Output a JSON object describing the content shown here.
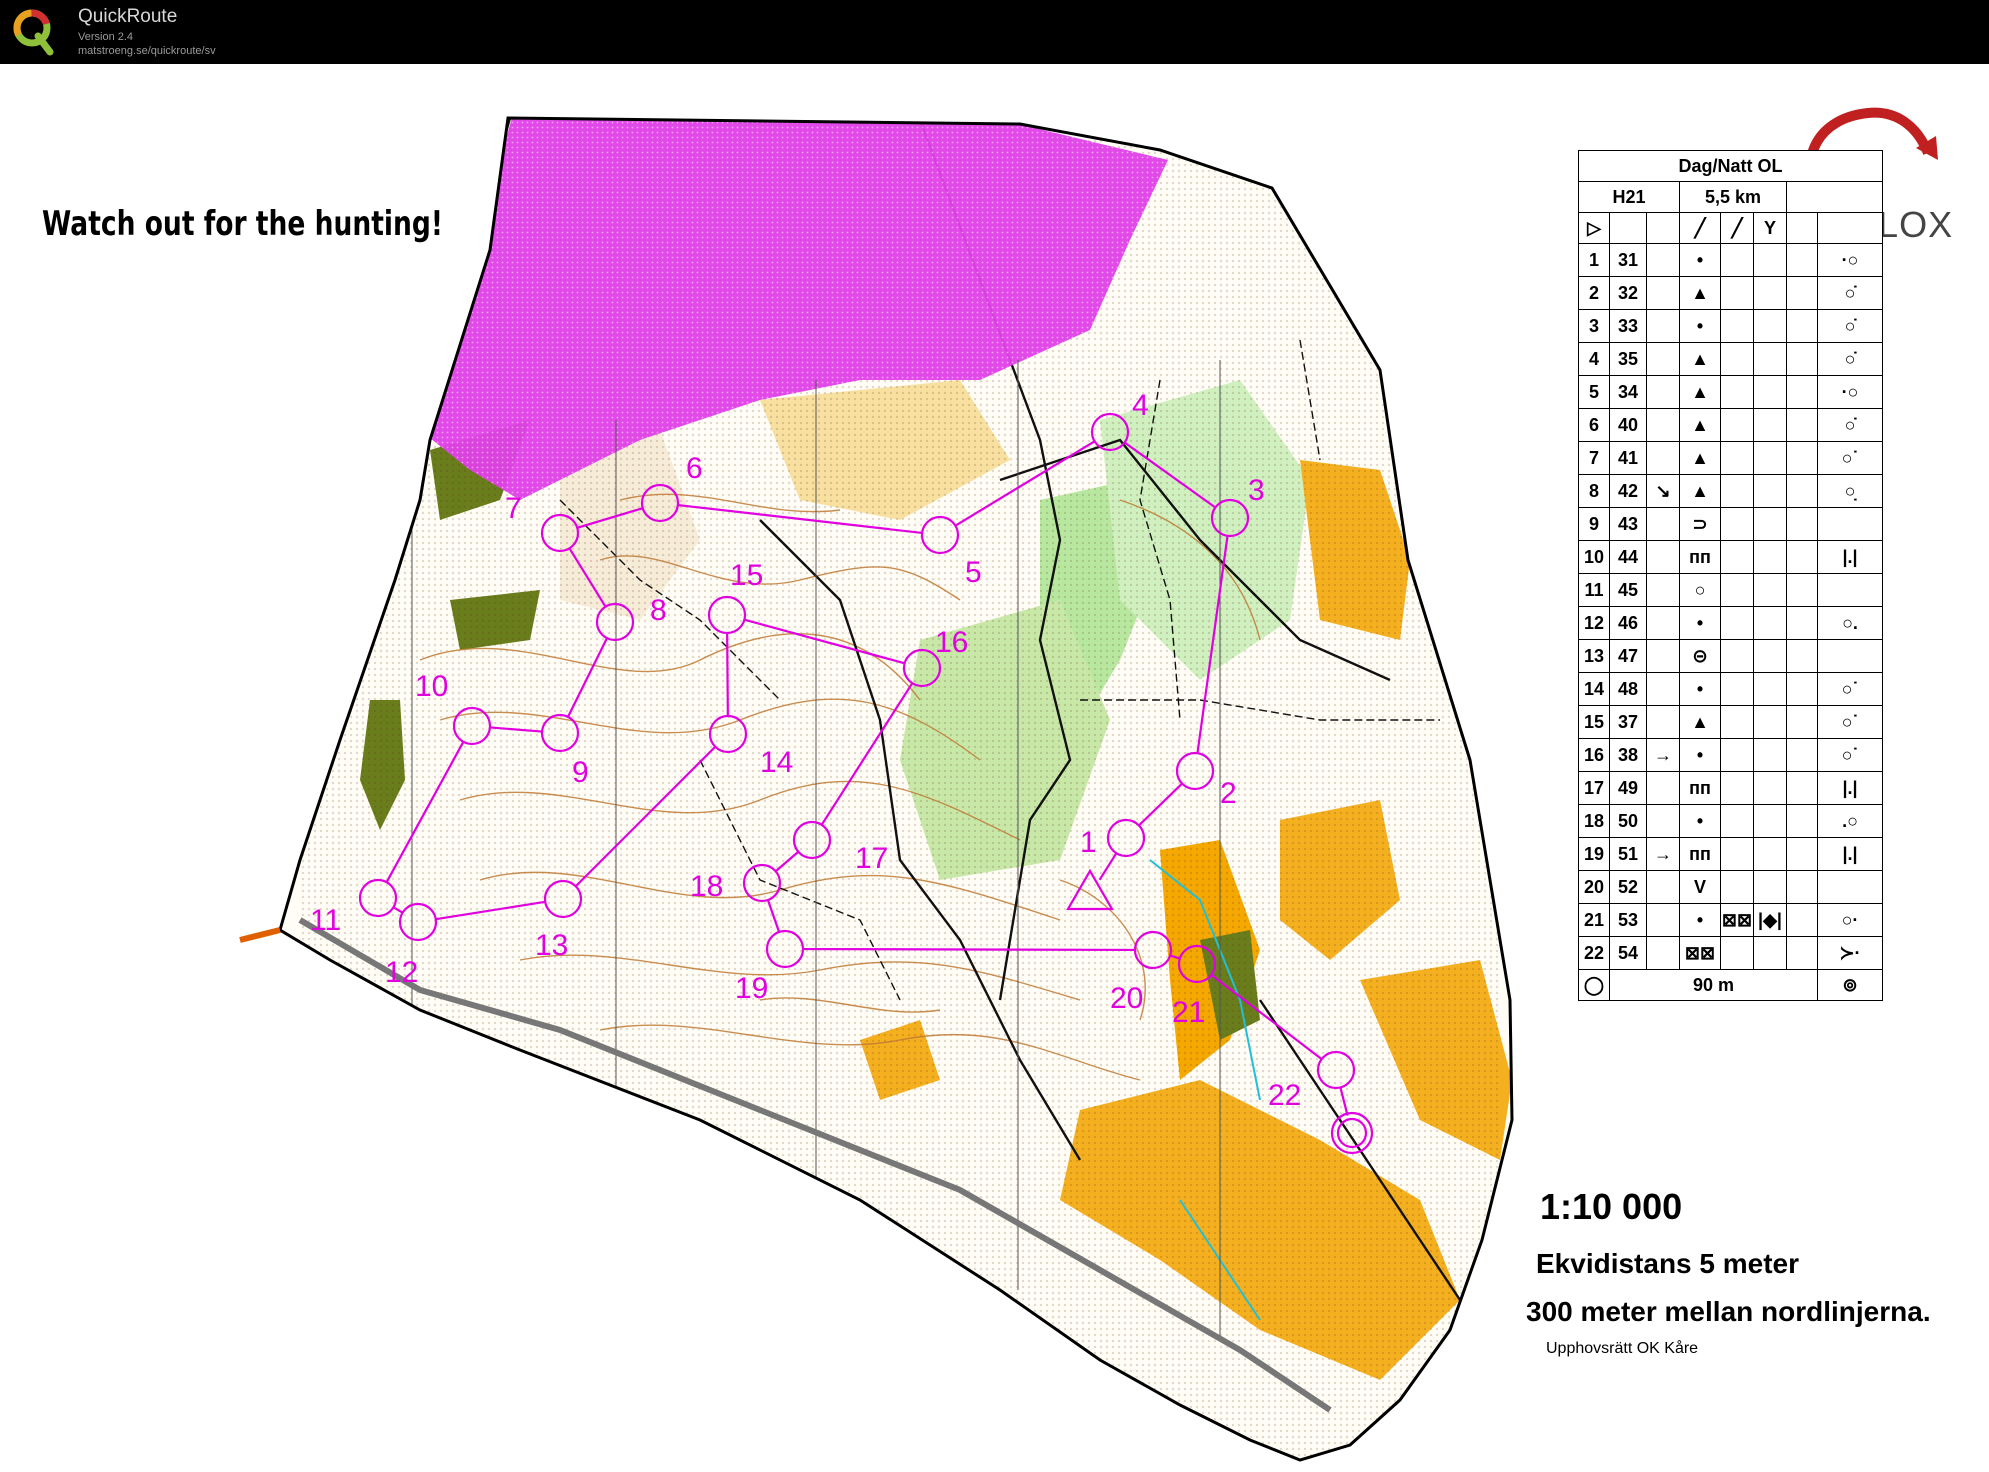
{
  "app": {
    "name": "QuickRoute",
    "version": "Version 2.4",
    "url": "matstroeng.se/quickroute/sv"
  },
  "map": {
    "warning": "Watch out for the hunting!",
    "brand": "LIVELOX",
    "scale": "1:10 000",
    "contour_interval": "Ekvidistans 5 meter",
    "north_lines": "300 meter mellan nordlinjerna.",
    "copyright": "Upphovsrätt OK Kåre",
    "colors": {
      "course": "#e000e0",
      "restricted": "#e040e8",
      "open_land": "#f5a800",
      "rough_open": "#f8e0a0",
      "green": "#a8e08c",
      "dark_green": "#6a7d1c",
      "contour": "#b8702a",
      "water": "#30c8e0"
    }
  },
  "course": {
    "event": "Dag/Natt OL",
    "class": "H21",
    "length": "5,5 km",
    "finish_distance": "90 m",
    "controls": [
      {
        "n": "1",
        "code": "31",
        "c": "•",
        "g": "·○"
      },
      {
        "n": "2",
        "code": "32",
        "c": "▲",
        "g": "○̇"
      },
      {
        "n": "3",
        "code": "33",
        "c": "•",
        "g": "○̇"
      },
      {
        "n": "4",
        "code": "35",
        "c": "▲",
        "g": "○̇"
      },
      {
        "n": "5",
        "code": "34",
        "c": "▲",
        "g": "·○"
      },
      {
        "n": "6",
        "code": "40",
        "c": "▲",
        "g": "○̇"
      },
      {
        "n": "7",
        "code": "41",
        "c": "▲",
        "g": "○˙"
      },
      {
        "n": "8",
        "code": "42",
        "c": "▲",
        "g": "○̣",
        "d": "↘"
      },
      {
        "n": "9",
        "code": "43",
        "c": "⊃",
        "g": ""
      },
      {
        "n": "10",
        "code": "44",
        "c": "ᴨᴨ",
        "g": "|.|"
      },
      {
        "n": "11",
        "code": "45",
        "c": "○",
        "g": ""
      },
      {
        "n": "12",
        "code": "46",
        "c": "•",
        "g": "○."
      },
      {
        "n": "13",
        "code": "47",
        "c": "⊝",
        "g": ""
      },
      {
        "n": "14",
        "code": "48",
        "c": "•",
        "g": "○˙"
      },
      {
        "n": "15",
        "code": "37",
        "c": "▲",
        "g": "○˙"
      },
      {
        "n": "16",
        "code": "38",
        "c": "•",
        "g": "○˙",
        "d": "→"
      },
      {
        "n": "17",
        "code": "49",
        "c": "ᴨᴨ",
        "g": "|.|"
      },
      {
        "n": "18",
        "code": "50",
        "c": "•",
        "g": ".○"
      },
      {
        "n": "19",
        "code": "51",
        "c": "ᴨᴨ",
        "g": "|.|",
        "d": "→"
      },
      {
        "n": "20",
        "code": "52",
        "c": "V",
        "g": ""
      },
      {
        "n": "21",
        "code": "53",
        "c": "•",
        "g": "○·",
        "b": "|◆|",
        "e": "⊠⊠"
      },
      {
        "n": "22",
        "code": "54",
        "c": "⊠⊠",
        "g": "≻·"
      }
    ],
    "map_labels": [
      "1",
      "2",
      "3",
      "4",
      "5",
      "6",
      "7",
      "8",
      "9",
      "10",
      "11",
      "12",
      "13",
      "14",
      "15",
      "16",
      "17",
      "18",
      "19",
      "20",
      "21",
      "22"
    ]
  }
}
